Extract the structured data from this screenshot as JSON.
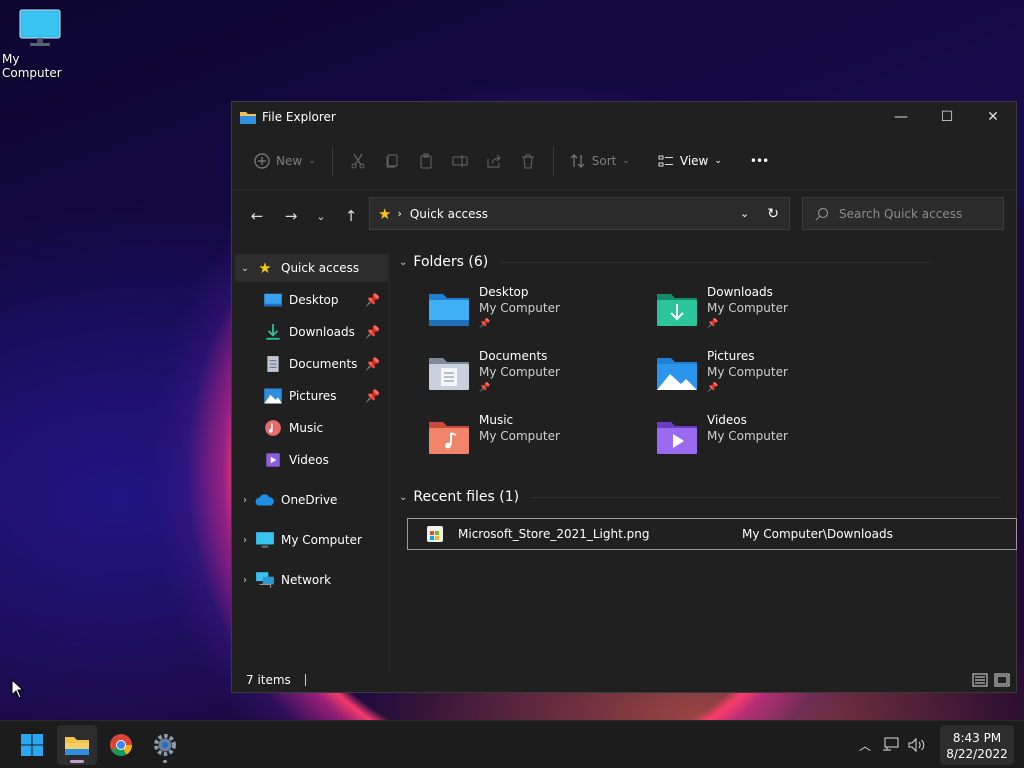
{
  "desktop": {
    "icon_label": "My Computer"
  },
  "window": {
    "title": "File Explorer",
    "controls": {
      "minimize": "—",
      "maximize": "☐",
      "close": "✕"
    }
  },
  "toolbar": {
    "new_label": "New",
    "sort_label": "Sort",
    "view_label": "View",
    "more_label": "•••"
  },
  "navigation": {
    "address_path": "Quick access",
    "search_placeholder": "Search Quick access"
  },
  "sidebar": {
    "quick_access": "Quick access",
    "pinned": [
      {
        "label": "Desktop",
        "icon": "desktop-folder-icon"
      },
      {
        "label": "Downloads",
        "icon": "download-icon"
      },
      {
        "label": "Documents",
        "icon": "document-icon"
      },
      {
        "label": "Pictures",
        "icon": "picture-icon"
      }
    ],
    "others": [
      {
        "label": "Music",
        "icon": "music-icon"
      },
      {
        "label": "Videos",
        "icon": "video-icon"
      }
    ],
    "roots": [
      {
        "label": "OneDrive",
        "icon": "cloud-icon"
      },
      {
        "label": "My Computer",
        "icon": "computer-icon"
      },
      {
        "label": "Network",
        "icon": "network-icon"
      }
    ]
  },
  "content": {
    "folders_header": "Folders (6)",
    "folders": [
      {
        "name": "Desktop",
        "location": "My Computer",
        "pinned": true
      },
      {
        "name": "Downloads",
        "location": "My Computer",
        "pinned": true
      },
      {
        "name": "Documents",
        "location": "My Computer",
        "pinned": true
      },
      {
        "name": "Pictures",
        "location": "My Computer",
        "pinned": true
      },
      {
        "name": "Music",
        "location": "My Computer",
        "pinned": false
      },
      {
        "name": "Videos",
        "location": "My Computer",
        "pinned": false
      }
    ],
    "recent_header": "Recent files (1)",
    "recent_files": [
      {
        "name": "Microsoft_Store_2021_Light.png",
        "location": "My Computer\\Downloads"
      }
    ]
  },
  "status": {
    "item_count": "7 items"
  },
  "taskbar": {
    "apps": [
      "start-icon",
      "file-explorer-icon",
      "chrome-icon",
      "settings-icon"
    ],
    "clock_time": "8:43 PM",
    "clock_date": "8/22/2022"
  },
  "colors": {
    "window_bg": "#202020",
    "accent_star": "#f5c518",
    "folder_blue": "#3aa0f0"
  }
}
